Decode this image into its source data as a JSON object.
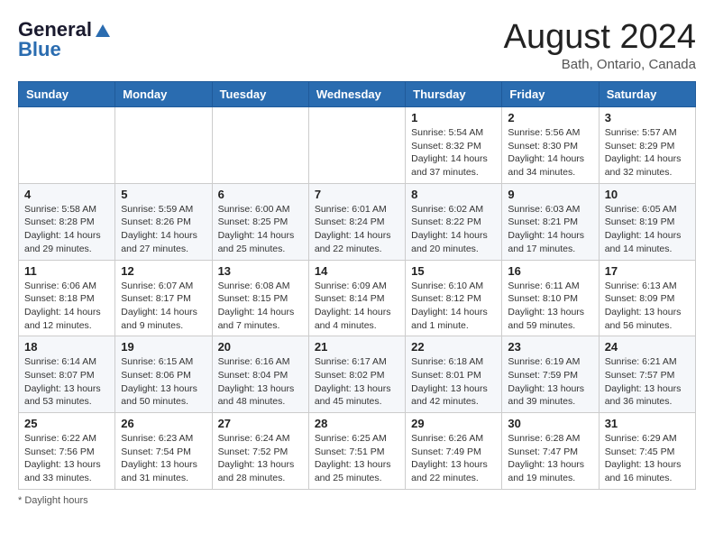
{
  "header": {
    "logo_line1": "General",
    "logo_line2": "Blue",
    "month": "August 2024",
    "location": "Bath, Ontario, Canada"
  },
  "weekdays": [
    "Sunday",
    "Monday",
    "Tuesday",
    "Wednesday",
    "Thursday",
    "Friday",
    "Saturday"
  ],
  "footer": {
    "daylight_label": "Daylight hours"
  },
  "weeks": [
    [
      {
        "day": "",
        "info": ""
      },
      {
        "day": "",
        "info": ""
      },
      {
        "day": "",
        "info": ""
      },
      {
        "day": "",
        "info": ""
      },
      {
        "day": "1",
        "info": "Sunrise: 5:54 AM\nSunset: 8:32 PM\nDaylight: 14 hours and 37 minutes."
      },
      {
        "day": "2",
        "info": "Sunrise: 5:56 AM\nSunset: 8:30 PM\nDaylight: 14 hours and 34 minutes."
      },
      {
        "day": "3",
        "info": "Sunrise: 5:57 AM\nSunset: 8:29 PM\nDaylight: 14 hours and 32 minutes."
      }
    ],
    [
      {
        "day": "4",
        "info": "Sunrise: 5:58 AM\nSunset: 8:28 PM\nDaylight: 14 hours and 29 minutes."
      },
      {
        "day": "5",
        "info": "Sunrise: 5:59 AM\nSunset: 8:26 PM\nDaylight: 14 hours and 27 minutes."
      },
      {
        "day": "6",
        "info": "Sunrise: 6:00 AM\nSunset: 8:25 PM\nDaylight: 14 hours and 25 minutes."
      },
      {
        "day": "7",
        "info": "Sunrise: 6:01 AM\nSunset: 8:24 PM\nDaylight: 14 hours and 22 minutes."
      },
      {
        "day": "8",
        "info": "Sunrise: 6:02 AM\nSunset: 8:22 PM\nDaylight: 14 hours and 20 minutes."
      },
      {
        "day": "9",
        "info": "Sunrise: 6:03 AM\nSunset: 8:21 PM\nDaylight: 14 hours and 17 minutes."
      },
      {
        "day": "10",
        "info": "Sunrise: 6:05 AM\nSunset: 8:19 PM\nDaylight: 14 hours and 14 minutes."
      }
    ],
    [
      {
        "day": "11",
        "info": "Sunrise: 6:06 AM\nSunset: 8:18 PM\nDaylight: 14 hours and 12 minutes."
      },
      {
        "day": "12",
        "info": "Sunrise: 6:07 AM\nSunset: 8:17 PM\nDaylight: 14 hours and 9 minutes."
      },
      {
        "day": "13",
        "info": "Sunrise: 6:08 AM\nSunset: 8:15 PM\nDaylight: 14 hours and 7 minutes."
      },
      {
        "day": "14",
        "info": "Sunrise: 6:09 AM\nSunset: 8:14 PM\nDaylight: 14 hours and 4 minutes."
      },
      {
        "day": "15",
        "info": "Sunrise: 6:10 AM\nSunset: 8:12 PM\nDaylight: 14 hours and 1 minute."
      },
      {
        "day": "16",
        "info": "Sunrise: 6:11 AM\nSunset: 8:10 PM\nDaylight: 13 hours and 59 minutes."
      },
      {
        "day": "17",
        "info": "Sunrise: 6:13 AM\nSunset: 8:09 PM\nDaylight: 13 hours and 56 minutes."
      }
    ],
    [
      {
        "day": "18",
        "info": "Sunrise: 6:14 AM\nSunset: 8:07 PM\nDaylight: 13 hours and 53 minutes."
      },
      {
        "day": "19",
        "info": "Sunrise: 6:15 AM\nSunset: 8:06 PM\nDaylight: 13 hours and 50 minutes."
      },
      {
        "day": "20",
        "info": "Sunrise: 6:16 AM\nSunset: 8:04 PM\nDaylight: 13 hours and 48 minutes."
      },
      {
        "day": "21",
        "info": "Sunrise: 6:17 AM\nSunset: 8:02 PM\nDaylight: 13 hours and 45 minutes."
      },
      {
        "day": "22",
        "info": "Sunrise: 6:18 AM\nSunset: 8:01 PM\nDaylight: 13 hours and 42 minutes."
      },
      {
        "day": "23",
        "info": "Sunrise: 6:19 AM\nSunset: 7:59 PM\nDaylight: 13 hours and 39 minutes."
      },
      {
        "day": "24",
        "info": "Sunrise: 6:21 AM\nSunset: 7:57 PM\nDaylight: 13 hours and 36 minutes."
      }
    ],
    [
      {
        "day": "25",
        "info": "Sunrise: 6:22 AM\nSunset: 7:56 PM\nDaylight: 13 hours and 33 minutes."
      },
      {
        "day": "26",
        "info": "Sunrise: 6:23 AM\nSunset: 7:54 PM\nDaylight: 13 hours and 31 minutes."
      },
      {
        "day": "27",
        "info": "Sunrise: 6:24 AM\nSunset: 7:52 PM\nDaylight: 13 hours and 28 minutes."
      },
      {
        "day": "28",
        "info": "Sunrise: 6:25 AM\nSunset: 7:51 PM\nDaylight: 13 hours and 25 minutes."
      },
      {
        "day": "29",
        "info": "Sunrise: 6:26 AM\nSunset: 7:49 PM\nDaylight: 13 hours and 22 minutes."
      },
      {
        "day": "30",
        "info": "Sunrise: 6:28 AM\nSunset: 7:47 PM\nDaylight: 13 hours and 19 minutes."
      },
      {
        "day": "31",
        "info": "Sunrise: 6:29 AM\nSunset: 7:45 PM\nDaylight: 13 hours and 16 minutes."
      }
    ]
  ]
}
